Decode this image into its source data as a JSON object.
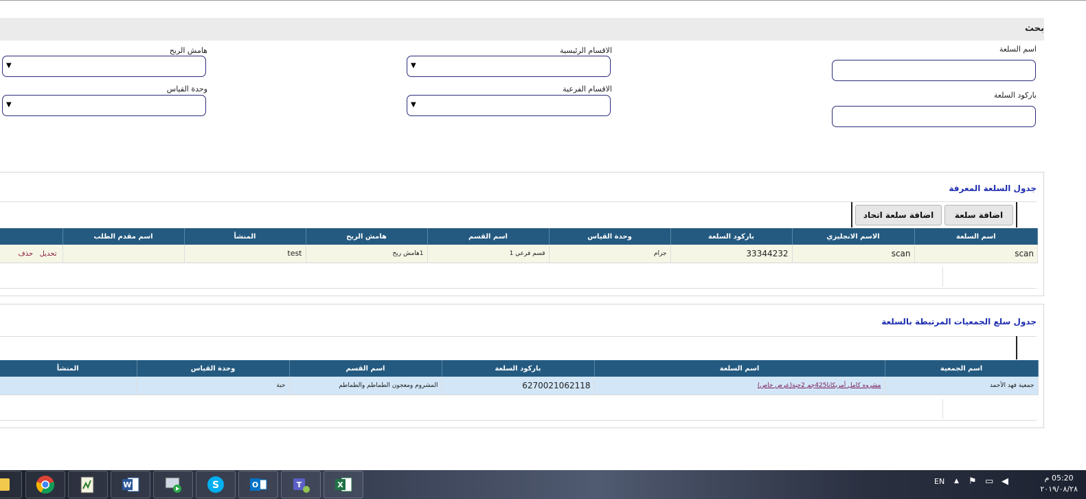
{
  "search": {
    "title": "بحث",
    "fields": {
      "item_name": "اسم السلعة",
      "item_barcode": "باركود السلعة",
      "main_sections": "الاقسام الرئيسية",
      "sub_sections": "الاقسام الفرعية",
      "profit_margin": "هامش الربح",
      "unit": "وحدة القياس"
    }
  },
  "defined_items": {
    "title": "جدول السلعة المعرفة",
    "add_button": "اضافة سلعة",
    "add_union_button": "اضافة سلعة اتحاد",
    "columns": [
      "اسم السلعة",
      "الاسم الانجليزي",
      "باركود السلعة",
      "وحدة القياس",
      "اسم القسم",
      "هامش الربح",
      "المنشأ",
      "اسم مقدم الطلب"
    ],
    "rows": [
      {
        "item_name": "scan",
        "english_name": "scan",
        "barcode": "33344232",
        "unit": "جرام",
        "section": "قسم فرعي 1",
        "margin": "1هامش ربح",
        "origin": "test",
        "requester": "",
        "edit": "تحديل",
        "delete": "حذف"
      }
    ]
  },
  "linked_items": {
    "title": "جدول سلع الجمعيات المرتبطة بالسلعة",
    "columns": [
      "اسم الجمعية",
      "اسم السلعة",
      "باركود السلعة",
      "اسم القسم",
      "وحدة القياس",
      "المنشأ"
    ],
    "rows": [
      {
        "society": "جمعية فهد الأحمد",
        "item_name": "مشروه كامل أمريكانا425جم 2حبة(عرض خاص)",
        "barcode": "6270021062118",
        "section": "المشروم ومعجون الطماطم والطماطم",
        "unit": "حبة",
        "origin": ""
      }
    ]
  },
  "taskbar": {
    "apps": [
      "file-explorer-icon",
      "chrome-icon",
      "notepad-icon",
      "word-icon",
      "remote-desktop-icon",
      "skype-icon",
      "outlook-icon",
      "teams-icon",
      "excel-icon"
    ],
    "language": "EN",
    "time": "05:20 م",
    "date": "٢٠١٩/٠٨/٢٨"
  }
}
